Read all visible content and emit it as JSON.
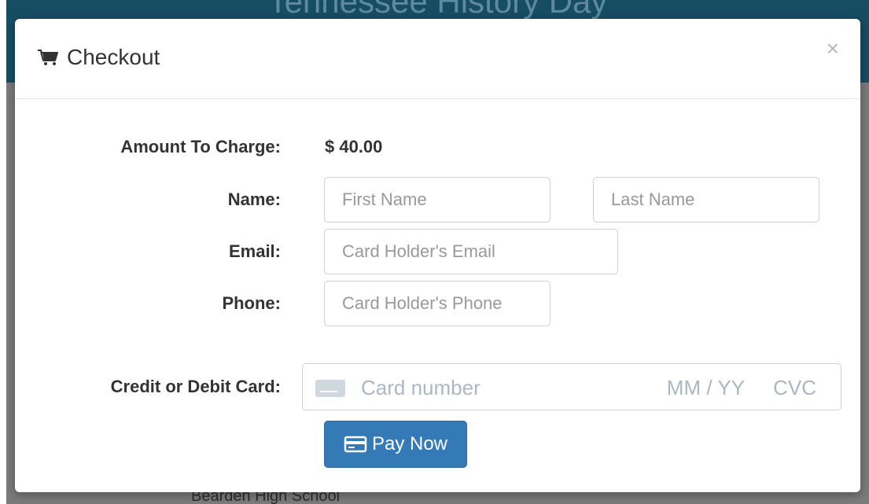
{
  "background": {
    "header_title": "Tennessee History Day",
    "footer_text": "Bearden High School"
  },
  "modal": {
    "title": "Checkout",
    "title_icon": "shopping-cart-icon",
    "close_label": "×"
  },
  "form": {
    "amount_label": "Amount To Charge:",
    "amount_value": "$ 40.00",
    "name_label": "Name:",
    "first_name_placeholder": "First Name",
    "last_name_placeholder": "Last Name",
    "email_label": "Email:",
    "email_placeholder": "Card Holder's Email",
    "phone_label": "Phone:",
    "phone_placeholder": "Card Holder's Phone",
    "card_label": "Credit or Debit Card:",
    "card_number_placeholder": "Card number",
    "card_expiry_placeholder": "MM / YY",
    "card_cvc_placeholder": "CVC"
  },
  "pay_button": {
    "label": "Pay Now",
    "icon": "credit-card-icon"
  },
  "colors": {
    "primary": "#337ab7",
    "header_bg": "#174d63"
  }
}
